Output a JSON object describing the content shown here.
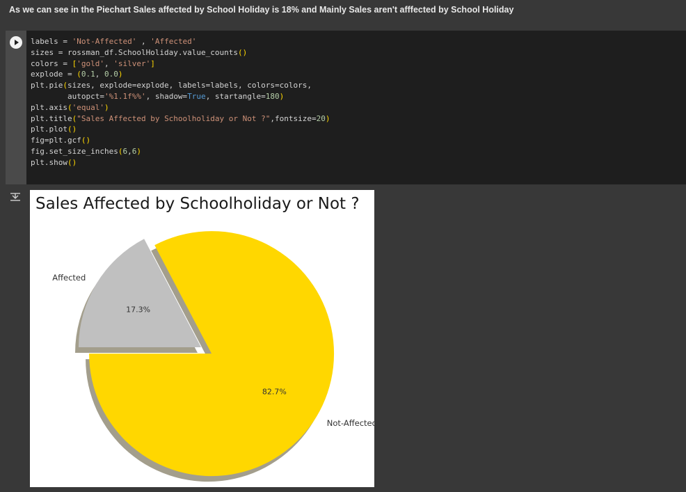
{
  "markdown": {
    "text": "As we can see in the Piechart Sales affected by School Holiday is 18% and Mainly Sales aren't afffected by School Holiday"
  },
  "code_cell": {
    "lines": [
      [
        {
          "t": "labels = "
        },
        {
          "t": "'Not-Affected'",
          "c": "str"
        },
        {
          "t": " , "
        },
        {
          "t": "'Affected'",
          "c": "str"
        }
      ],
      [
        {
          "t": "sizes = rossman_df.SchoolHoliday.value_counts"
        },
        {
          "t": "()",
          "c": "paren"
        }
      ],
      [
        {
          "t": "colors = "
        },
        {
          "t": "[",
          "c": "paren"
        },
        {
          "t": "'gold'",
          "c": "str"
        },
        {
          "t": ", "
        },
        {
          "t": "'silver'",
          "c": "str"
        },
        {
          "t": "]",
          "c": "paren"
        }
      ],
      [
        {
          "t": "explode = "
        },
        {
          "t": "(",
          "c": "paren"
        },
        {
          "t": "0.1",
          "c": "num"
        },
        {
          "t": ", "
        },
        {
          "t": "0.0",
          "c": "num"
        },
        {
          "t": ")",
          "c": "paren"
        }
      ],
      [
        {
          "t": "plt.pie"
        },
        {
          "t": "(",
          "c": "paren"
        },
        {
          "t": "sizes, explode=explode, labels=labels, colors=colors,"
        }
      ],
      [
        {
          "t": "        autopct="
        },
        {
          "t": "'%1.1f%%'",
          "c": "str"
        },
        {
          "t": ", shadow="
        },
        {
          "t": "True",
          "c": "kw"
        },
        {
          "t": ", startangle="
        },
        {
          "t": "180",
          "c": "num"
        },
        {
          "t": ")",
          "c": "paren"
        }
      ],
      [
        {
          "t": "plt.axis"
        },
        {
          "t": "(",
          "c": "paren"
        },
        {
          "t": "'equal'",
          "c": "str"
        },
        {
          "t": ")",
          "c": "paren"
        }
      ],
      [
        {
          "t": "plt.title"
        },
        {
          "t": "(",
          "c": "paren"
        },
        {
          "t": "\"Sales Affected by Schoolholiday or Not ?\"",
          "c": "str"
        },
        {
          "t": ",fontsize="
        },
        {
          "t": "20",
          "c": "num"
        },
        {
          "t": ")",
          "c": "paren"
        }
      ],
      [
        {
          "t": "plt.plot"
        },
        {
          "t": "()",
          "c": "paren"
        }
      ],
      [
        {
          "t": "fig=plt.gcf"
        },
        {
          "t": "()",
          "c": "paren"
        }
      ],
      [
        {
          "t": "fig.set_size_inches"
        },
        {
          "t": "(",
          "c": "paren"
        },
        {
          "t": "6",
          "c": "num"
        },
        {
          "t": ","
        },
        {
          "t": "6",
          "c": "num"
        },
        {
          "t": ")",
          "c": "paren"
        }
      ],
      [
        {
          "t": "plt.show"
        },
        {
          "t": "()",
          "c": "paren"
        }
      ]
    ]
  },
  "icons": {
    "run": "play-circle-icon",
    "output_toggle": "output-toggle-icon"
  },
  "colors": {
    "page_bg": "#383838",
    "code_bg": "#1e1e1e",
    "gold": "#ffd700",
    "silver": "#c0c0c0",
    "shadow": "#a39e8c"
  },
  "chart_data": {
    "type": "pie",
    "title": "Sales Affected by Schoolholiday or Not ?",
    "labels": [
      "Not-Affected",
      "Affected"
    ],
    "values": [
      82.7,
      17.3
    ],
    "autopct_labels": [
      "82.7%",
      "17.3%"
    ],
    "colors": [
      "#ffd700",
      "#c0c0c0"
    ],
    "explode": [
      0.1,
      0.0
    ],
    "startangle": 180,
    "shadow": true
  }
}
